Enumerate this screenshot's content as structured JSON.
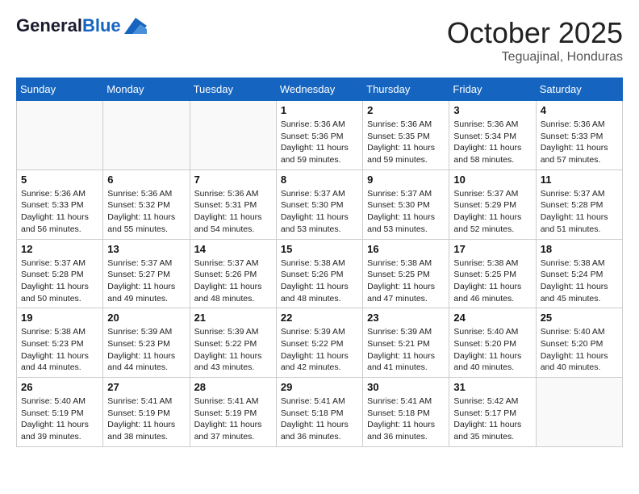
{
  "header": {
    "logo_line1": "General",
    "logo_line2": "Blue",
    "month": "October 2025",
    "location": "Teguajinal, Honduras"
  },
  "weekdays": [
    "Sunday",
    "Monday",
    "Tuesday",
    "Wednesday",
    "Thursday",
    "Friday",
    "Saturday"
  ],
  "weeks": [
    [
      {
        "day": "",
        "info": ""
      },
      {
        "day": "",
        "info": ""
      },
      {
        "day": "",
        "info": ""
      },
      {
        "day": "1",
        "info": "Sunrise: 5:36 AM\nSunset: 5:36 PM\nDaylight: 11 hours\nand 59 minutes."
      },
      {
        "day": "2",
        "info": "Sunrise: 5:36 AM\nSunset: 5:35 PM\nDaylight: 11 hours\nand 59 minutes."
      },
      {
        "day": "3",
        "info": "Sunrise: 5:36 AM\nSunset: 5:34 PM\nDaylight: 11 hours\nand 58 minutes."
      },
      {
        "day": "4",
        "info": "Sunrise: 5:36 AM\nSunset: 5:33 PM\nDaylight: 11 hours\nand 57 minutes."
      }
    ],
    [
      {
        "day": "5",
        "info": "Sunrise: 5:36 AM\nSunset: 5:33 PM\nDaylight: 11 hours\nand 56 minutes."
      },
      {
        "day": "6",
        "info": "Sunrise: 5:36 AM\nSunset: 5:32 PM\nDaylight: 11 hours\nand 55 minutes."
      },
      {
        "day": "7",
        "info": "Sunrise: 5:36 AM\nSunset: 5:31 PM\nDaylight: 11 hours\nand 54 minutes."
      },
      {
        "day": "8",
        "info": "Sunrise: 5:37 AM\nSunset: 5:30 PM\nDaylight: 11 hours\nand 53 minutes."
      },
      {
        "day": "9",
        "info": "Sunrise: 5:37 AM\nSunset: 5:30 PM\nDaylight: 11 hours\nand 53 minutes."
      },
      {
        "day": "10",
        "info": "Sunrise: 5:37 AM\nSunset: 5:29 PM\nDaylight: 11 hours\nand 52 minutes."
      },
      {
        "day": "11",
        "info": "Sunrise: 5:37 AM\nSunset: 5:28 PM\nDaylight: 11 hours\nand 51 minutes."
      }
    ],
    [
      {
        "day": "12",
        "info": "Sunrise: 5:37 AM\nSunset: 5:28 PM\nDaylight: 11 hours\nand 50 minutes."
      },
      {
        "day": "13",
        "info": "Sunrise: 5:37 AM\nSunset: 5:27 PM\nDaylight: 11 hours\nand 49 minutes."
      },
      {
        "day": "14",
        "info": "Sunrise: 5:37 AM\nSunset: 5:26 PM\nDaylight: 11 hours\nand 48 minutes."
      },
      {
        "day": "15",
        "info": "Sunrise: 5:38 AM\nSunset: 5:26 PM\nDaylight: 11 hours\nand 48 minutes."
      },
      {
        "day": "16",
        "info": "Sunrise: 5:38 AM\nSunset: 5:25 PM\nDaylight: 11 hours\nand 47 minutes."
      },
      {
        "day": "17",
        "info": "Sunrise: 5:38 AM\nSunset: 5:25 PM\nDaylight: 11 hours\nand 46 minutes."
      },
      {
        "day": "18",
        "info": "Sunrise: 5:38 AM\nSunset: 5:24 PM\nDaylight: 11 hours\nand 45 minutes."
      }
    ],
    [
      {
        "day": "19",
        "info": "Sunrise: 5:38 AM\nSunset: 5:23 PM\nDaylight: 11 hours\nand 44 minutes."
      },
      {
        "day": "20",
        "info": "Sunrise: 5:39 AM\nSunset: 5:23 PM\nDaylight: 11 hours\nand 44 minutes."
      },
      {
        "day": "21",
        "info": "Sunrise: 5:39 AM\nSunset: 5:22 PM\nDaylight: 11 hours\nand 43 minutes."
      },
      {
        "day": "22",
        "info": "Sunrise: 5:39 AM\nSunset: 5:22 PM\nDaylight: 11 hours\nand 42 minutes."
      },
      {
        "day": "23",
        "info": "Sunrise: 5:39 AM\nSunset: 5:21 PM\nDaylight: 11 hours\nand 41 minutes."
      },
      {
        "day": "24",
        "info": "Sunrise: 5:40 AM\nSunset: 5:20 PM\nDaylight: 11 hours\nand 40 minutes."
      },
      {
        "day": "25",
        "info": "Sunrise: 5:40 AM\nSunset: 5:20 PM\nDaylight: 11 hours\nand 40 minutes."
      }
    ],
    [
      {
        "day": "26",
        "info": "Sunrise: 5:40 AM\nSunset: 5:19 PM\nDaylight: 11 hours\nand 39 minutes."
      },
      {
        "day": "27",
        "info": "Sunrise: 5:41 AM\nSunset: 5:19 PM\nDaylight: 11 hours\nand 38 minutes."
      },
      {
        "day": "28",
        "info": "Sunrise: 5:41 AM\nSunset: 5:19 PM\nDaylight: 11 hours\nand 37 minutes."
      },
      {
        "day": "29",
        "info": "Sunrise: 5:41 AM\nSunset: 5:18 PM\nDaylight: 11 hours\nand 36 minutes."
      },
      {
        "day": "30",
        "info": "Sunrise: 5:41 AM\nSunset: 5:18 PM\nDaylight: 11 hours\nand 36 minutes."
      },
      {
        "day": "31",
        "info": "Sunrise: 5:42 AM\nSunset: 5:17 PM\nDaylight: 11 hours\nand 35 minutes."
      },
      {
        "day": "",
        "info": ""
      }
    ]
  ]
}
